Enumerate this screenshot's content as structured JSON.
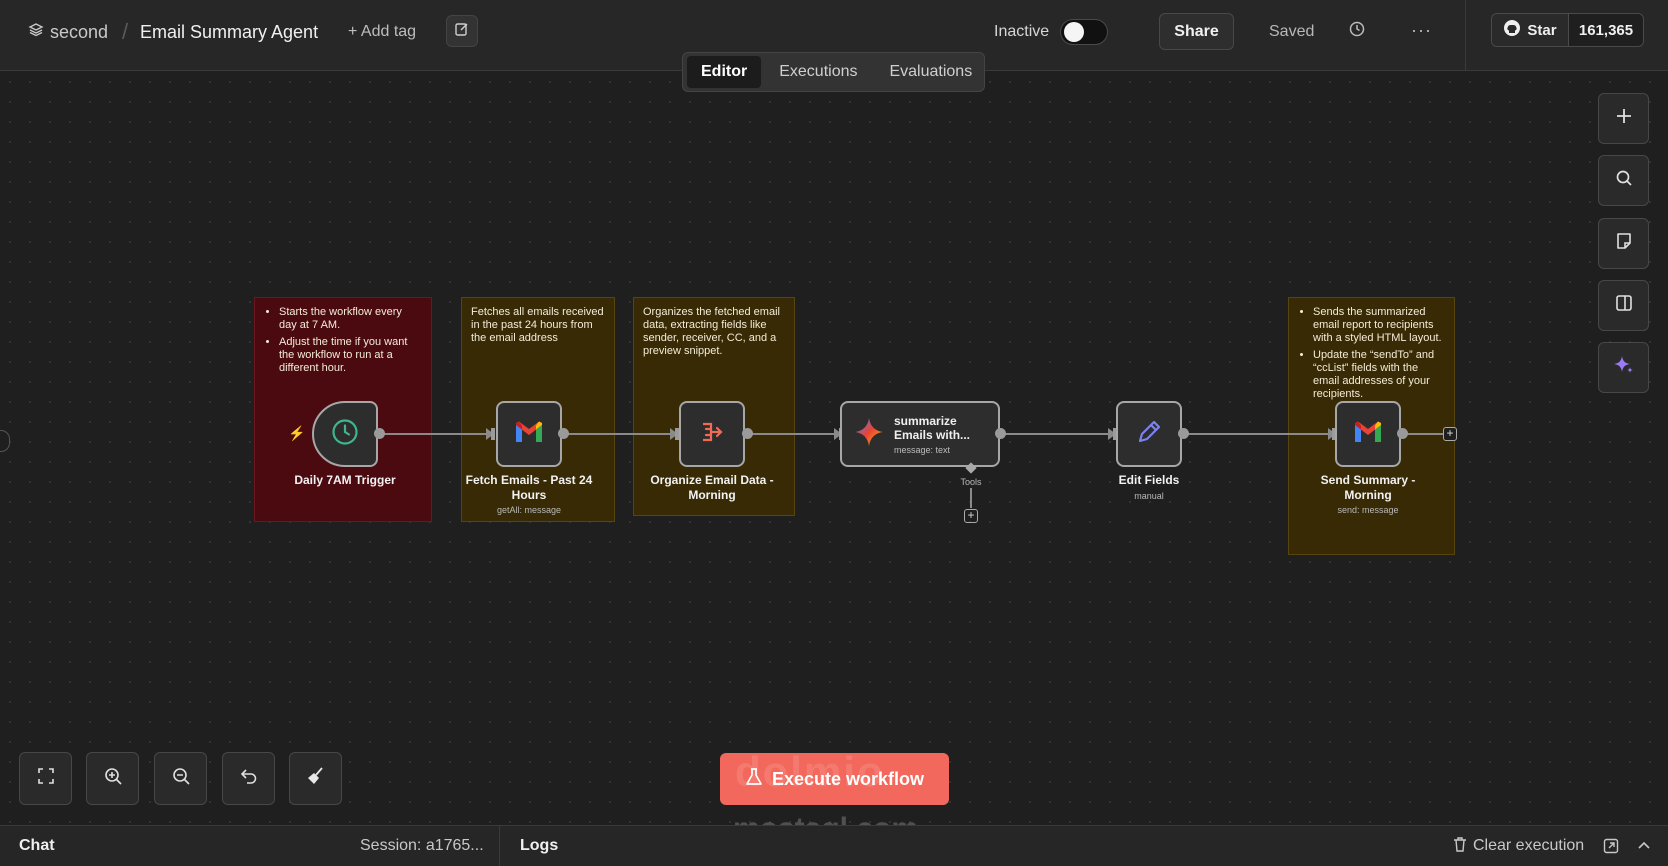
{
  "header": {
    "project": "second",
    "separator": "/",
    "title": "Email Summary Agent",
    "add_tag": "+ Add tag",
    "active_label": "Inactive",
    "share": "Share",
    "saved": "Saved",
    "more": "···",
    "github_star": "Star",
    "github_count": "161,365"
  },
  "tabs": [
    "Editor",
    "Executions",
    "Evaluations"
  ],
  "sticky_notes": {
    "trigger": [
      "Starts the workflow every day at 7 AM.",
      "Adjust the time if you want the workflow to run at a different hour."
    ],
    "fetch": "Fetches all emails received in the past 24 hours from the email address",
    "organize": "Organizes the fetched email data, extracting fields like sender, receiver, CC, and a preview snippet.",
    "send": [
      "Sends the summarized email report to recipients with a styled HTML layout.",
      "Update the “sendTo” and “ccList” fields with the email addresses of your recipients."
    ]
  },
  "nodes": {
    "trigger": {
      "title": "Daily 7AM Trigger"
    },
    "fetch": {
      "title": "Fetch Emails - Past 24 Hours",
      "subtitle": "getAll: message"
    },
    "organize": {
      "title": "Organize Email Data - Morning"
    },
    "summarize": {
      "title": "summarize Emails with...",
      "subtitle": "message: text",
      "tools_label": "Tools"
    },
    "edit": {
      "title": "Edit Fields",
      "subtitle": "manual"
    },
    "send": {
      "title": "Send Summary - Morning",
      "subtitle": "send: message"
    }
  },
  "execute_button": "Execute workflow",
  "watermark": {
    "logo": "dolmio",
    "site": "mostaql.com"
  },
  "bottom": {
    "chat": "Chat",
    "session": "Session: a1765...",
    "logs": "Logs",
    "clear_execution": "Clear execution"
  },
  "colors": {
    "accent": "#f3685c",
    "sticky_red": "#4a0a10",
    "sticky_yellow": "#372a05"
  }
}
